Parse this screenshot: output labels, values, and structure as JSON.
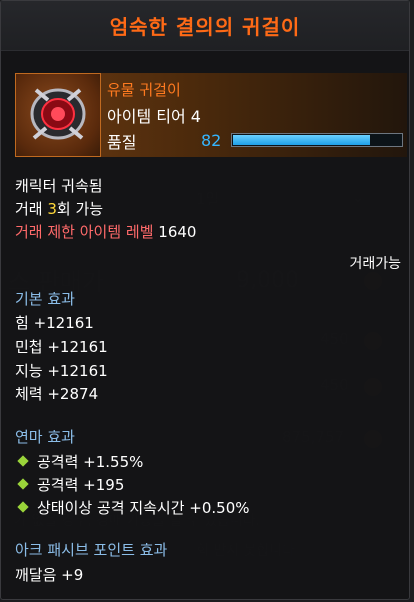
{
  "title": "엄숙한 결의의 귀걸이",
  "item": {
    "grade": "유물 귀걸이",
    "tier": "아이템 티어 4",
    "quality_label": "품질",
    "quality_value": "82",
    "quality_fraction": 0.82,
    "icon": "earring-icon"
  },
  "binding": "캐릭터 귀속됨",
  "trade": {
    "prefix": "거래 ",
    "count": "3",
    "suffix": "회 가능"
  },
  "trade_level": {
    "label": "거래 제한 아이템 레벨",
    "value": "1640"
  },
  "tradeable": "거래가능",
  "base": {
    "title": "기본 효과",
    "stats": [
      "힘 +12161",
      "민첩 +12161",
      "지능 +12161",
      "체력 +2874"
    ]
  },
  "refine": {
    "title": "연마 효과",
    "effects": [
      "공격력 +1.55%",
      "공격력 +195",
      "상태이상 공격 지속시간 +0.50%"
    ]
  },
  "ark": {
    "title": "아크 패시브 포인트 효과",
    "value": "깨달음 +9"
  },
  "colors": {
    "accent": "#ff6a16",
    "section": "#8bbde8",
    "quality": "#35b6ff"
  }
}
